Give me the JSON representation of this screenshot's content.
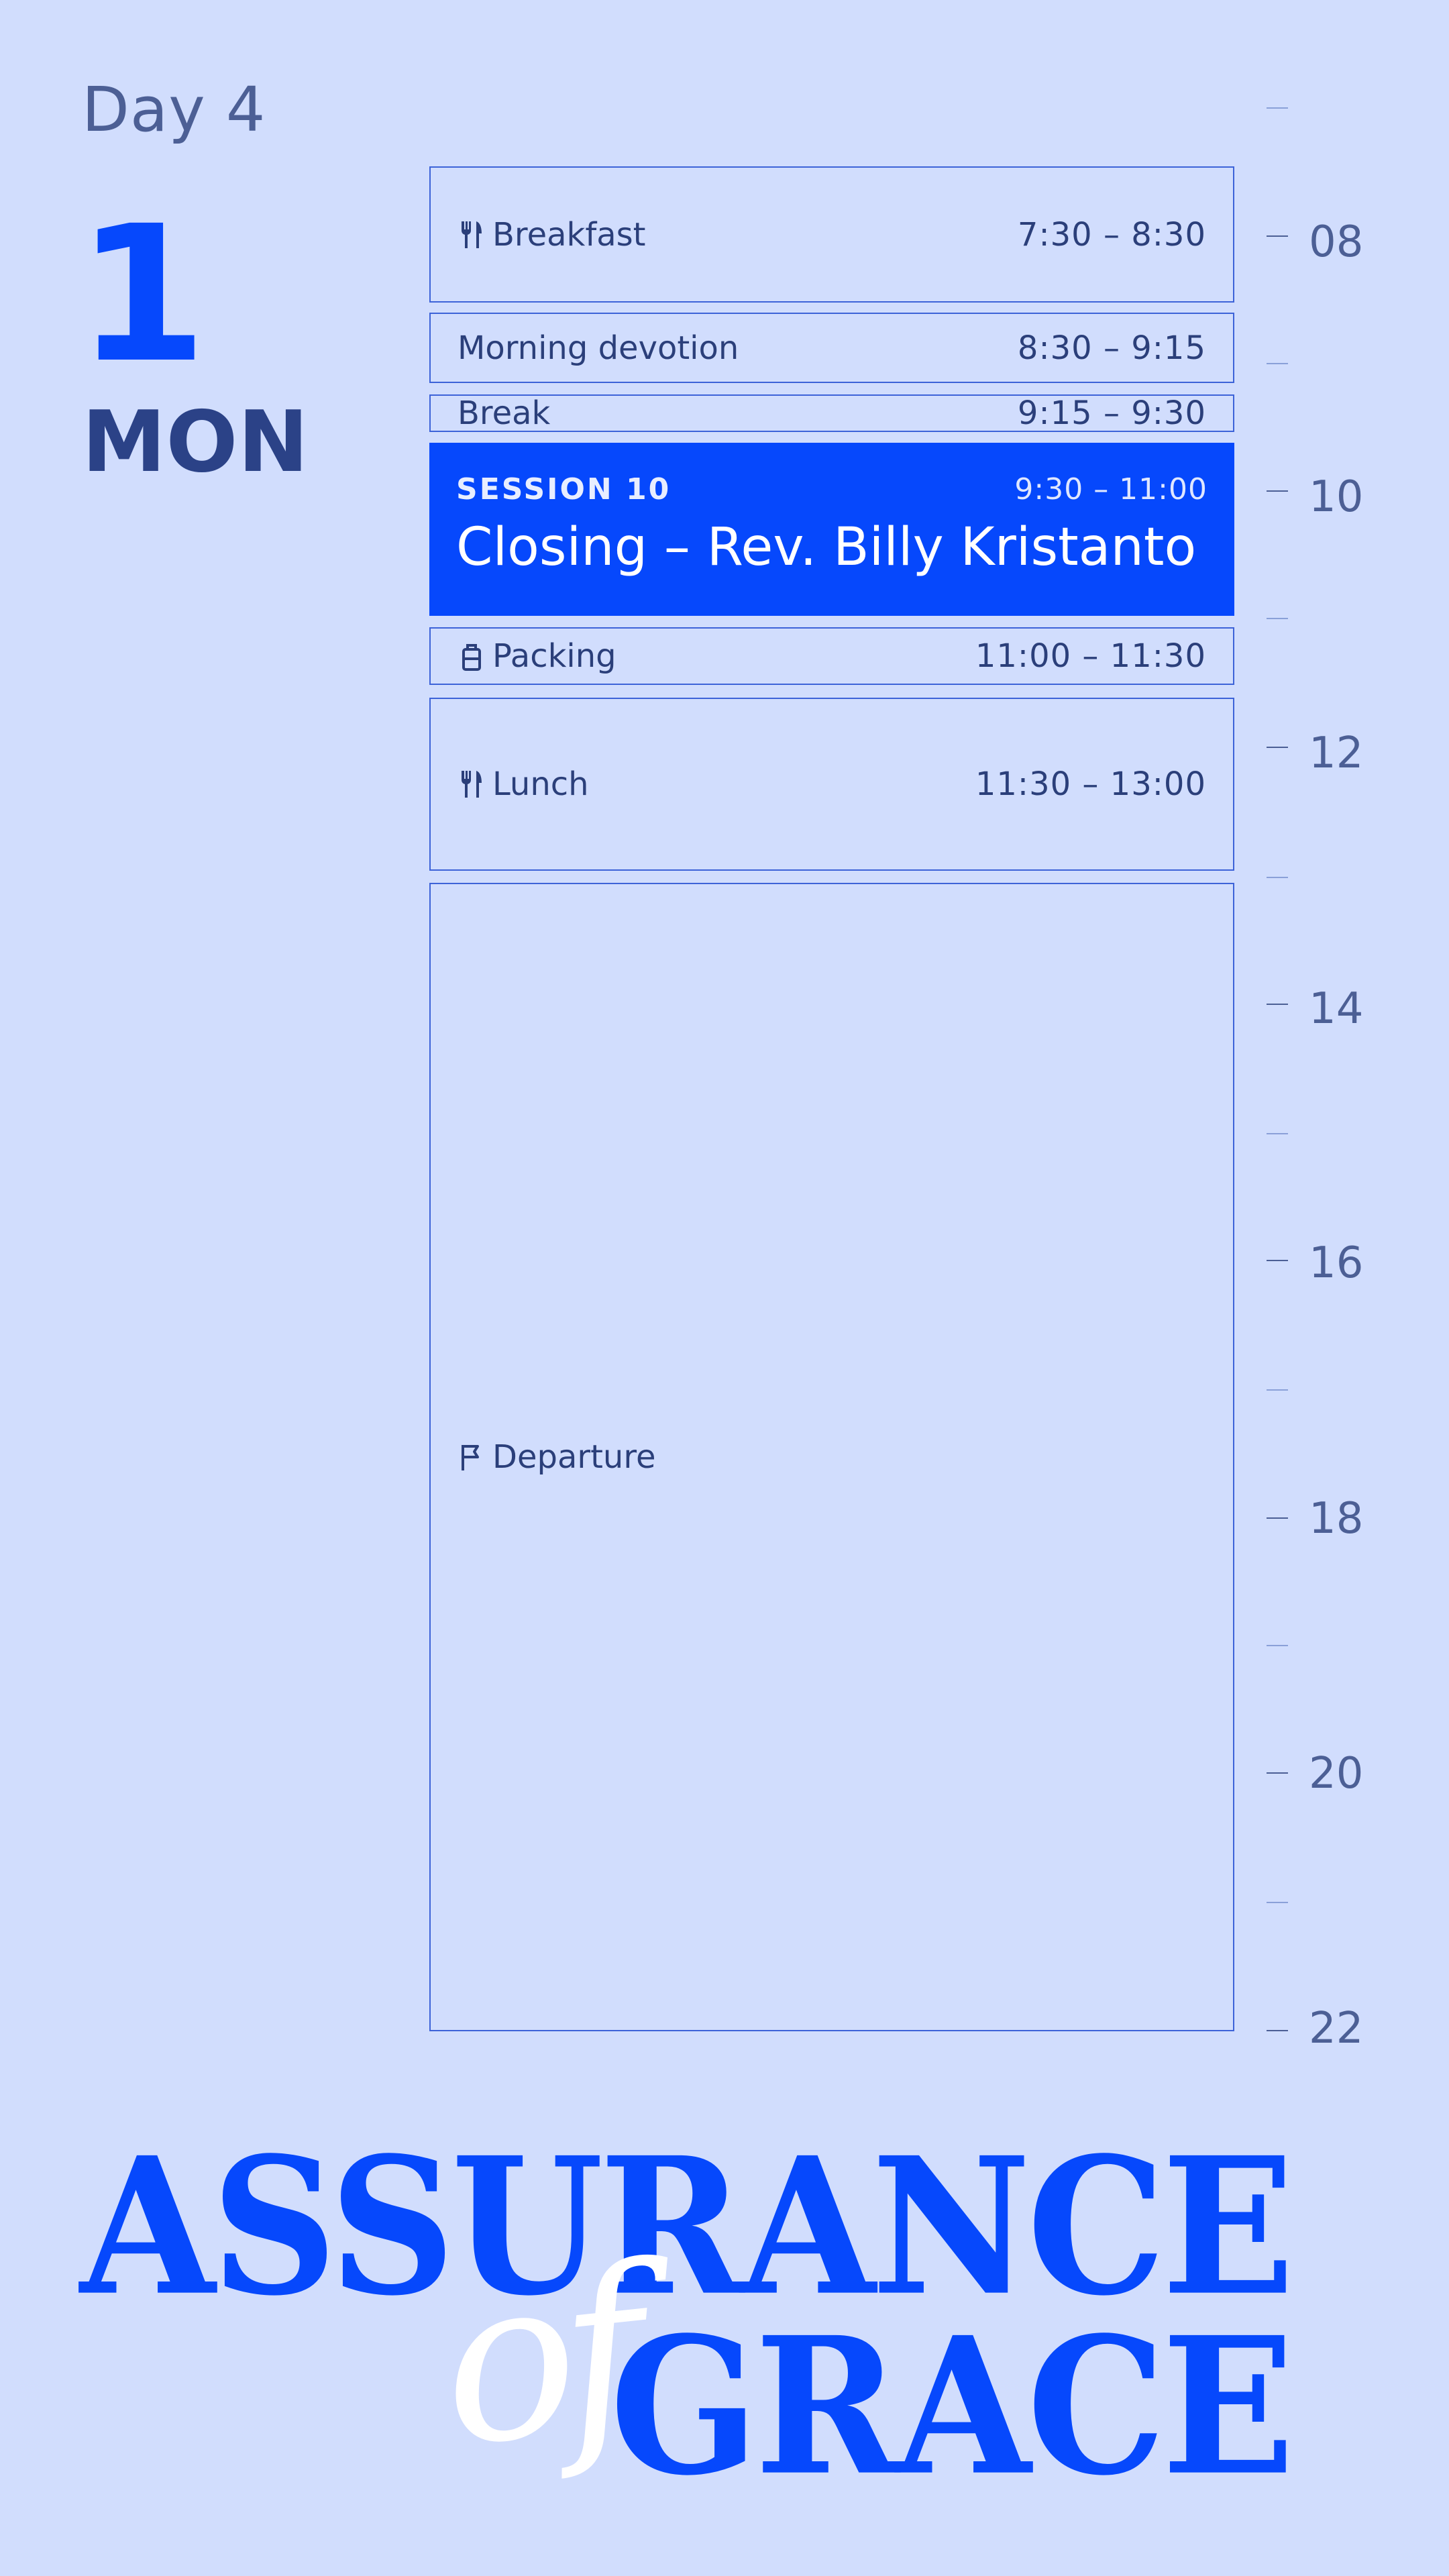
{
  "header": {
    "day_label": "Day 4",
    "date_number": "1",
    "weekday": "MON"
  },
  "axis": {
    "hours": [
      "08",
      "10",
      "12",
      "14",
      "16",
      "18",
      "20",
      "22"
    ]
  },
  "events": {
    "breakfast": {
      "name": "Breakfast",
      "time": "7:30 – 8:30",
      "icon": "utensils-icon"
    },
    "devotion": {
      "name": "Morning devotion",
      "time": "8:30 – 9:15"
    },
    "break": {
      "name": "Break",
      "time": "9:15 – 9:30"
    },
    "session": {
      "kicker": "SESSION 10",
      "time": "9:30 – 11:00",
      "title": "Closing – Rev. Billy Kristanto"
    },
    "packing": {
      "name": "Packing",
      "time": "11:00 – 11:30",
      "icon": "luggage-icon"
    },
    "lunch": {
      "name": "Lunch",
      "time": "11:30 – 13:00",
      "icon": "utensils-icon"
    },
    "departure": {
      "name": "Departure",
      "icon": "flag-icon"
    }
  },
  "branding": {
    "line1": "ASSURANCE",
    "connector": "of",
    "line2": "GRACE"
  },
  "colors": {
    "background": "#d1ddfd",
    "accent": "#0648fc",
    "text_muted": "#4c5f95",
    "text_dark": "#2b4287"
  }
}
